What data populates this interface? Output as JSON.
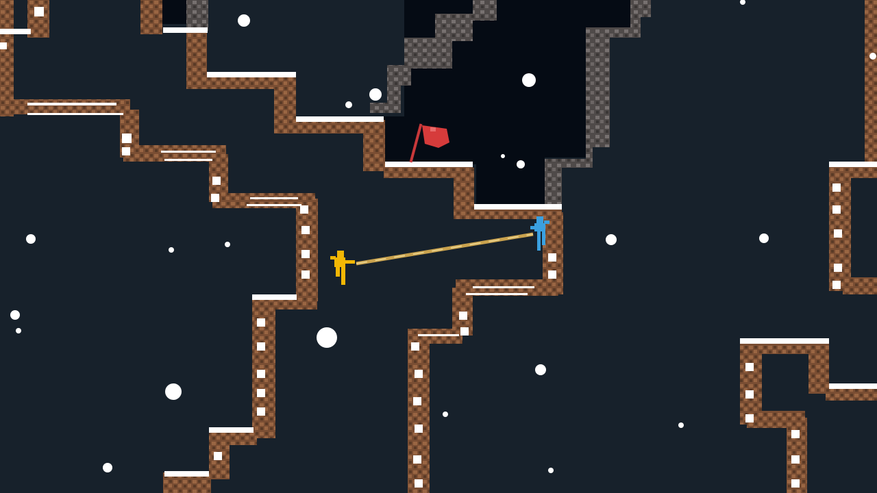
{
  "game": {
    "hud_text": [],
    "palette": {
      "sky": "#17212b",
      "cave_interior": "#050b14",
      "rock_brown": "#8a5a3a",
      "rock_dark": "#5a3a26",
      "rock_gray": "#6f6a68",
      "snow": "#ffffff",
      "flag": "#d63b3b",
      "flag_pole": "#c8383a",
      "rope": "#c9a24e",
      "player_yellow": "#f2b705",
      "player_blue": "#3aa0e0"
    },
    "entities": [
      {
        "name": "yellow-climber",
        "color": "player_yellow"
      },
      {
        "name": "blue-climber",
        "color": "player_blue"
      },
      {
        "name": "goal-flag",
        "color": "flag"
      }
    ]
  }
}
